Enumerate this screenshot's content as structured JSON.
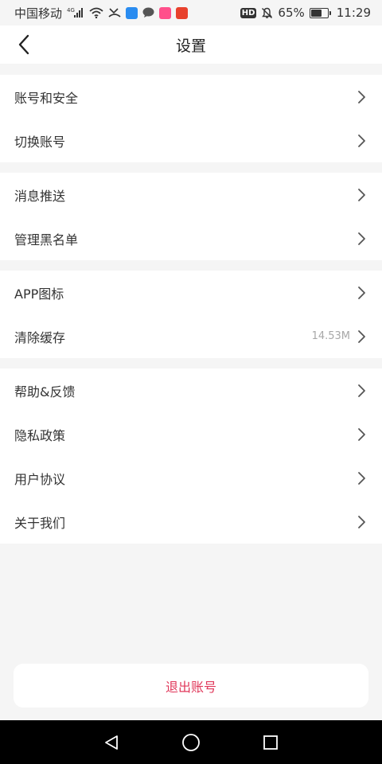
{
  "status_bar": {
    "carrier": "中国移动",
    "network": "4G",
    "battery_text": "65%",
    "battery_level": 0.65,
    "hd_label": "HD",
    "time": "11:29"
  },
  "header": {
    "title": "设置"
  },
  "groups": [
    {
      "items": [
        {
          "label": "账号和安全"
        },
        {
          "label": "切换账号"
        }
      ]
    },
    {
      "items": [
        {
          "label": "消息推送"
        },
        {
          "label": "管理黑名单"
        }
      ]
    },
    {
      "items": [
        {
          "label": "APP图标"
        },
        {
          "label": "清除缓存",
          "value": "14.53M"
        }
      ]
    },
    {
      "items": [
        {
          "label": "帮助&反馈"
        },
        {
          "label": "隐私政策"
        },
        {
          "label": "用户协议"
        },
        {
          "label": "关于我们"
        }
      ]
    }
  ],
  "logout_label": "退出账号",
  "colors": {
    "accent": "#e0375a",
    "background": "#f5f5f5",
    "card": "#ffffff"
  }
}
